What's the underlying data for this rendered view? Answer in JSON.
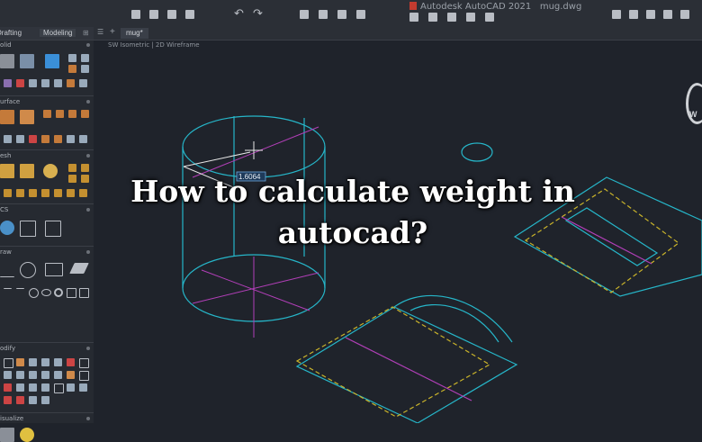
{
  "app": {
    "title": "Autodesk AutoCAD 2021",
    "file": "mug.dwg"
  },
  "palette": {
    "tabs": [
      "Drafting",
      "Modeling"
    ],
    "sections": [
      "olid",
      "urface",
      "esh",
      "CS",
      "raw",
      "odify",
      "isualize"
    ]
  },
  "document_tab": "mug*",
  "view_label": "SW Isometric | 2D Wireframe",
  "dimension_value": "1.6064",
  "headline": {
    "line1": "How to calculate weight in",
    "line2": "autocad?"
  },
  "viewcube_letter": "W",
  "colors": {
    "accent_cyan": "#26b6c9",
    "dashed_yellow": "#c9b32a",
    "magenta": "#b23fb8",
    "brand_red": "#c23b2f"
  },
  "icons": [
    "new-icon",
    "open-icon",
    "save-icon",
    "saveas-icon",
    "undo-icon",
    "redo-icon",
    "plot-icon",
    "print-preview-icon",
    "publish-icon",
    "properties-icon",
    "layer-icon",
    "match-icon",
    "pan-icon",
    "tools-icon",
    "help-icon"
  ]
}
